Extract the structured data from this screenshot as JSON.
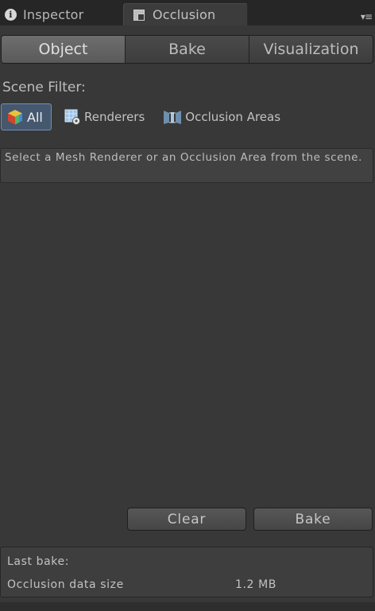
{
  "window_tabs": [
    {
      "label": "Inspector",
      "icon": "info-icon"
    },
    {
      "label": "Occlusion",
      "icon": "occlusion-icon"
    }
  ],
  "toolbar": {
    "tabs": [
      "Object",
      "Bake",
      "Visualization"
    ],
    "active": "Object"
  },
  "scene_filter": {
    "label": "Scene Filter:",
    "options": [
      {
        "label": "All",
        "icon": "cube-icon",
        "selected": true
      },
      {
        "label": "Renderers",
        "icon": "renderer-icon",
        "selected": false
      },
      {
        "label": "Occlusion Areas",
        "icon": "occlusion-area-icon",
        "selected": false
      }
    ]
  },
  "help_text": "Select a Mesh Renderer or an Occlusion Area from the scene.",
  "buttons": {
    "clear": "Clear",
    "bake": "Bake"
  },
  "stats": {
    "last_bake_label": "Last bake:",
    "data_size_label": "Occlusion data size",
    "data_size_value": "1.2 MB"
  },
  "colors": {
    "background": "#383838",
    "selected_filter": "#45586e",
    "selected_filter_border": "#6f8fb4"
  }
}
